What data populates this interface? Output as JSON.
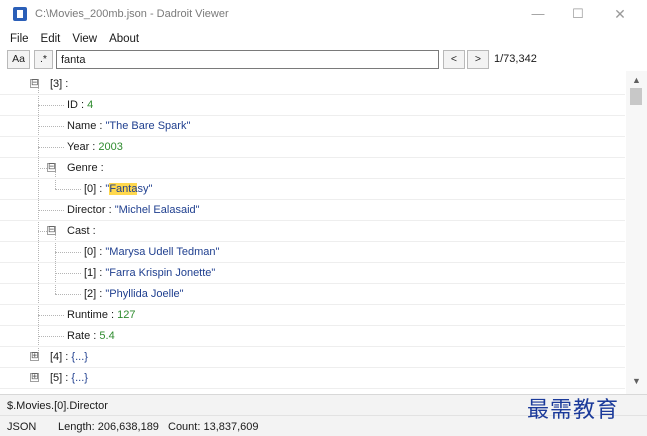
{
  "window": {
    "title": "C:\\Movies_200mb.json - Dadroit Viewer",
    "controls": {
      "minimize": "—",
      "maximize": "☐",
      "close": "✕"
    }
  },
  "menu": [
    "File",
    "Edit",
    "View",
    "About"
  ],
  "search": {
    "case_label": "Aa",
    "regex_label": ".*",
    "value": "fanta",
    "prev_label": "<",
    "next_label": ">",
    "match_count": "1/73,342"
  },
  "tree": {
    "item3_key": "[3]",
    "item3_suffix": " :",
    "fields": {
      "id": {
        "key": "ID",
        "value": "4"
      },
      "name": {
        "key": "Name",
        "value": "\"The Bare Spark\""
      },
      "year": {
        "key": "Year",
        "value": "2003"
      },
      "genre": {
        "key": "Genre",
        "value": ""
      },
      "genre0": {
        "key": "[0]",
        "value_pre": "\"",
        "value_match": "Fanta",
        "value_post": "sy\""
      },
      "director": {
        "key": "Director",
        "value": "\"Michel Ealasaid\""
      },
      "cast": {
        "key": "Cast",
        "value": ""
      },
      "cast0": {
        "key": "[0]",
        "value": "\"Marysa Udell Tedman\""
      },
      "cast1": {
        "key": "[1]",
        "value": "\"Farra Krispin Jonette\""
      },
      "cast2": {
        "key": "[2]",
        "value": "\"Phyllida Joelle\""
      },
      "runtime": {
        "key": "Runtime",
        "value": "127"
      },
      "rate": {
        "key": "Rate",
        "value": "5.4"
      }
    },
    "item4": {
      "key": "[4]",
      "value": "{...}"
    },
    "item5": {
      "key": "[5]",
      "value": "{...}"
    },
    "separator": " : "
  },
  "path": "$.Movies.[0].Director",
  "status": {
    "type": "JSON",
    "length": "Length: 206,638,189",
    "count": "Count: 13,837,609"
  },
  "watermark": "最需教育",
  "icons": {
    "collapse": "⊟",
    "expand": "⊞",
    "scroll_up": "▲",
    "scroll_down": "▼"
  },
  "colors": {
    "string": "#1f3f8f",
    "number": "#2e8b2e",
    "highlight": "#ffd84d",
    "watermark": "#1b3a9a"
  }
}
